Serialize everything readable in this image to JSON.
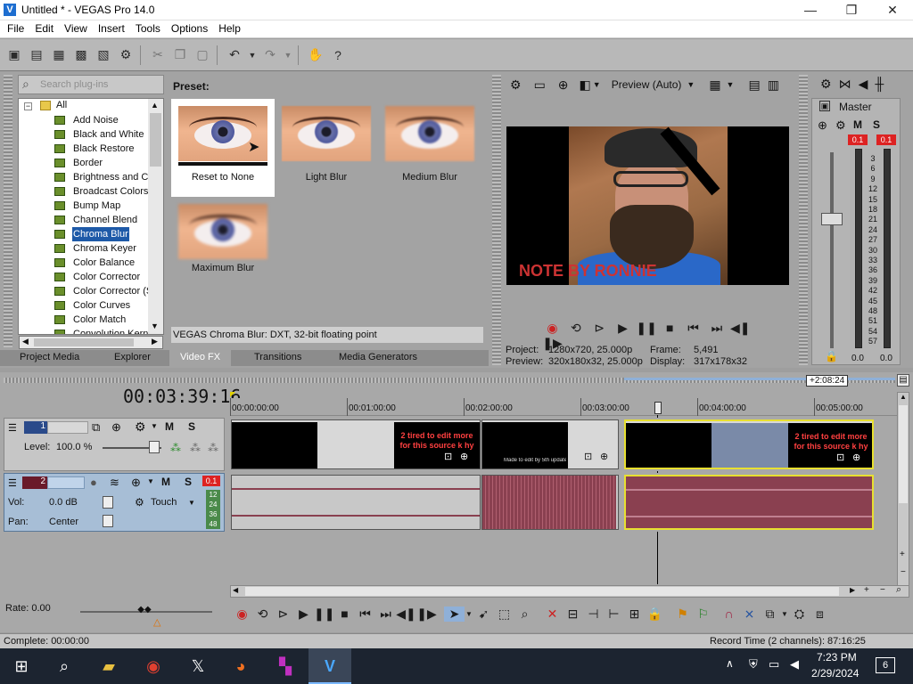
{
  "window": {
    "title": "Untitled * - VEGAS Pro 14.0",
    "minimize": "—",
    "maximize": "❐",
    "close": "✕"
  },
  "menu": [
    "File",
    "Edit",
    "View",
    "Insert",
    "Tools",
    "Options",
    "Help"
  ],
  "plugins": {
    "search_placeholder": "Search plug-ins",
    "root": "All",
    "items": [
      "Add Noise",
      "Black and White",
      "Black Restore",
      "Border",
      "Brightness and Co",
      "Broadcast Colors",
      "Bump Map",
      "Channel Blend",
      "Chroma Blur",
      "Chroma Keyer",
      "Color Balance",
      "Color Corrector",
      "Color Corrector (S",
      "Color Curves",
      "Color Match",
      "Convolution Kerne"
    ],
    "selected": "Chroma Blur"
  },
  "presets": {
    "label": "Preset:",
    "items": [
      "Reset to None",
      "Light Blur",
      "Medium Blur",
      "Maximum Blur"
    ],
    "selected": "Reset to None",
    "info": "VEGAS Chroma Blur: DXT, 32-bit floating point"
  },
  "tabs": [
    "Project Media",
    "Explorer",
    "Video FX",
    "Transitions",
    "Media Generators"
  ],
  "active_tab": "Video FX",
  "preview": {
    "mode": "Preview (Auto)",
    "caption": "NOTE BY RONNIE",
    "project_label": "Project:",
    "project": "1280x720, 25.000p",
    "preview_label": "Preview:",
    "preview": "320x180x32, 25.000p",
    "frame_label": "Frame:",
    "frame": "5,491",
    "display_label": "Display:",
    "display": "317x178x32"
  },
  "mixer": {
    "label": "Master",
    "peak_left": "0.1",
    "peak_right": "0.1",
    "scale": [
      "3",
      "6",
      "9",
      "12",
      "15",
      "18",
      "21",
      "24",
      "27",
      "30",
      "33",
      "36",
      "39",
      "42",
      "45",
      "48",
      "51",
      "54",
      "57"
    ],
    "fader_left": "0.0",
    "fader_right": "0.0"
  },
  "timeline": {
    "timecode": "00:03:39:16",
    "loop_time": "+2:08:24",
    "ruler": [
      "00:00:00:00",
      "00:01:00:00",
      "00:02:00:00",
      "00:03:00:00",
      "00:04:00:00",
      "00:05:00:00"
    ],
    "track1": {
      "number": "1",
      "level_label": "Level:",
      "level": "100.0 %"
    },
    "track2": {
      "number": "2",
      "peak": "0.1",
      "vol_label": "Vol:",
      "vol": "0.0 dB",
      "pan_label": "Pan:",
      "pan": "Center",
      "touch": "Touch",
      "meter_scale": [
        "12",
        "24",
        "36",
        "48"
      ]
    },
    "clip_text": "2 tired to edit more for this source k hy",
    "clip_text_small": "Made to edit by 5th update",
    "rate_label": "Rate:",
    "rate": "0.00"
  },
  "status": {
    "complete": "Complete: 00:00:00",
    "record": "Record Time (2 channels): 87:16:25"
  },
  "taskbar": {
    "time": "7:23 PM",
    "date": "2/29/2024",
    "notifications": "6"
  },
  "colors": {
    "selection": "#1e5aa8",
    "accent_red": "#dd2222",
    "track2": "#a7bed6"
  }
}
